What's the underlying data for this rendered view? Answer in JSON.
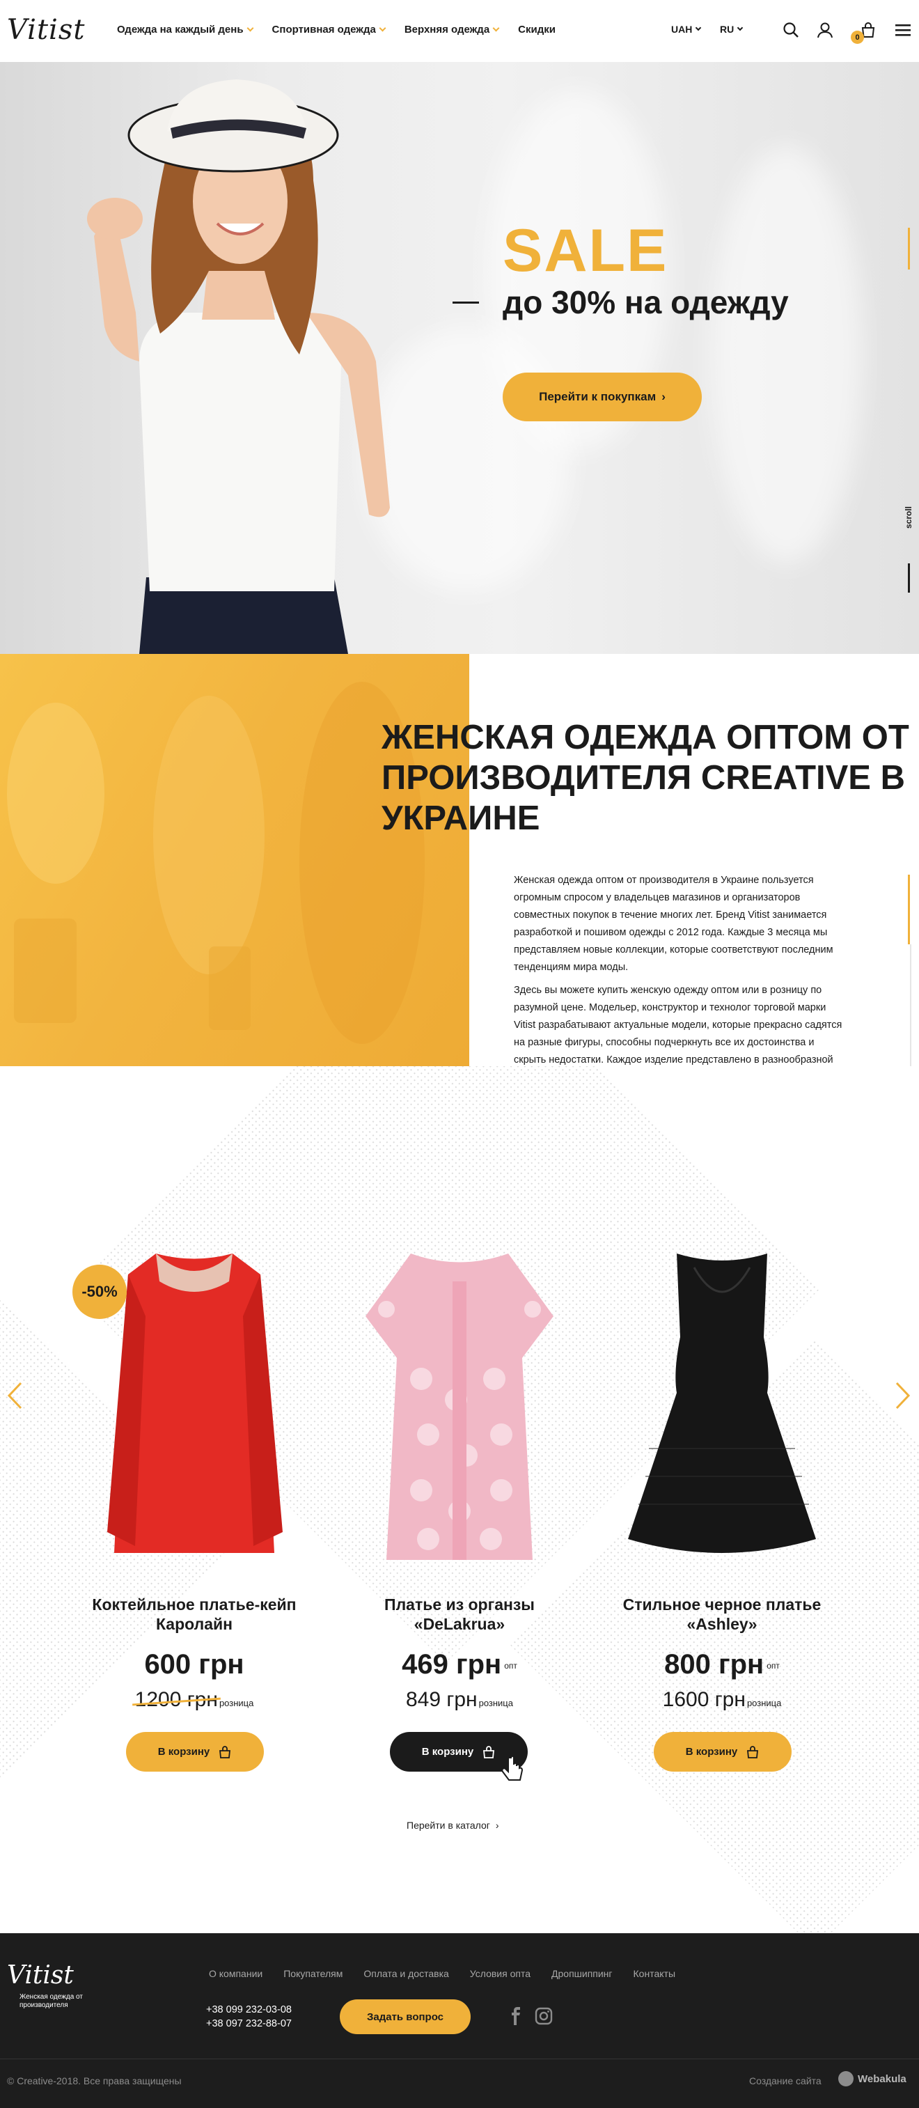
{
  "colors": {
    "accent": "#f0b13a",
    "dark": "#1b1b1b",
    "footer_bg": "#1d1d1d"
  },
  "header": {
    "logo": "Vitist",
    "nav": [
      {
        "label": "Одежда на каждый день"
      },
      {
        "label": "Спортивная одежда"
      },
      {
        "label": "Верхняя одежда"
      },
      {
        "label": "Скидки"
      }
    ],
    "currency": "UAH",
    "language": "RU",
    "cart_count": "0",
    "icons": [
      "search-icon",
      "user-icon",
      "cart-icon",
      "menu-icon"
    ]
  },
  "hero": {
    "title": "SALE",
    "subtitle": "до 30% на одежду",
    "button": "Перейти к покупкам",
    "scroll_label": "scroll"
  },
  "about": {
    "title": "ЖЕНСКАЯ ОДЕЖДА ОПТОМ ОТ ПРОИЗВОДИТЕЛЯ CREATIVE В УКРАИНЕ",
    "paragraph1": "Женская одежда оптом от производителя в Украине пользуется огромным спросом у владельцев магазинов и организаторов совместных покупок в течение многих лет. Бренд Vitist занимается разработкой и пошивом одежды с 2012 года. Каждые 3 месяца мы представляем новые коллекции, которые соответствуют последним тенденциям мира моды.",
    "paragraph2": "Здесь вы можете купить женскую одежду оптом или в розницу по разумной цене. Модельер, конструктор и технолог торговой марки Vitist разрабатывают актуальные модели, которые прекрасно садятся на разные фигуры, способны подчеркнуть все их достоинства и скрыть недостатки. Каждое изделие представлено в разнообразной цветовой гамме и размерах."
  },
  "products": [
    {
      "name": "Коктейльное платье-кейп Каролайн",
      "price": "600 грн",
      "price_note": "",
      "retail_price": "1200 грн",
      "retail_note": "розница",
      "badge": "-50%",
      "button": "В корзину",
      "dress_color": "#e32b25"
    },
    {
      "name": "Платье из органзы «DeLakrua»",
      "price": "469 грн",
      "price_note": "опт",
      "retail_price": "849 грн",
      "retail_note": "розница",
      "badge": "",
      "button": "В корзину",
      "dress_color": "#f1b8c6"
    },
    {
      "name": "Стильное черное платье «Ashley»",
      "price": "800 грн",
      "price_note": "опт",
      "retail_price": "1600 грн",
      "retail_note": "розница",
      "badge": "",
      "button": "В корзину",
      "dress_color": "#161616"
    }
  ],
  "catalog_link": "Перейти в каталог",
  "footer": {
    "logo": "Vitist",
    "tagline": "Женская одежда от производителя",
    "menu": [
      "О компании",
      "Покупателям",
      "Оплата и доставка",
      "Условия опта",
      "Дропшиппинг",
      "Контакты"
    ],
    "phone1": "+38 099 232-03-08",
    "phone2": "+38 097 232-88-07",
    "button": "Задать вопрос",
    "social": [
      "facebook-icon",
      "instagram-icon"
    ],
    "copyright": "© Creative-2018. Все права защищены",
    "made_by": "Создание сайта",
    "studio": "Webakula"
  }
}
